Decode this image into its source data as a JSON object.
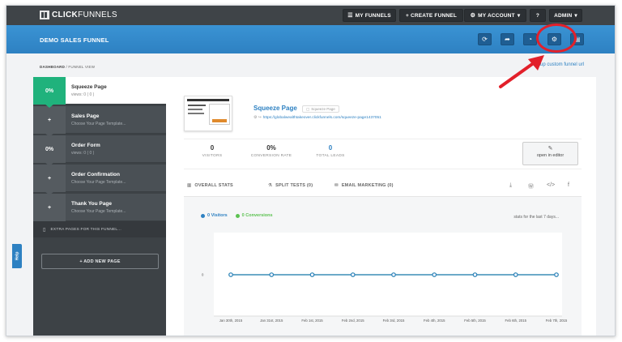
{
  "brand": {
    "name_bold": "CLICK",
    "name_light": "FUNNELS"
  },
  "topnav": {
    "my_funnels": "MY FUNNELS",
    "create_funnel": "+ CREATE FUNNEL",
    "my_account": "MY ACCOUNT",
    "help": "?",
    "admin": "ADMIN"
  },
  "funnel": {
    "title": "DEMO SALES FUNNEL"
  },
  "breadcrumb": {
    "root": "DASHBOARD",
    "sep": "/",
    "current": "FUNNEL VIEW"
  },
  "setup_link": "setup custom funnel url",
  "steps": [
    {
      "pct": "0%",
      "name": "Squeeze Page",
      "sub": "views: 0 ( 0 )",
      "active": true
    },
    {
      "pct": "+",
      "name": "Sales Page",
      "sub": "Choose Your Page Template...",
      "active": false
    },
    {
      "pct": "0%",
      "name": "Order Form",
      "sub": "views: 0 ( 0 )",
      "active": false
    },
    {
      "pct": "+",
      "name": "Order Confirmation",
      "sub": "Choose Your Page Template...",
      "active": false
    },
    {
      "pct": "+",
      "name": "Thank You Page",
      "sub": "Choose Your Page Template...",
      "active": false
    }
  ],
  "extra_pages": "EXTRA PAGES FOR THIS FUNNEL...",
  "add_new_page": "+ ADD NEW PAGE",
  "help_tab": "Help",
  "page": {
    "title": "Squeeze Page",
    "badge": "Squeeze Page",
    "url": "https://globalwealthtakeover.clickfunnels.com/squeeze-page1437051"
  },
  "stats": [
    {
      "value": "0",
      "label": "VISITORS"
    },
    {
      "value": "0%",
      "label": "CONVERSION RATE"
    },
    {
      "value": "0",
      "label": "TOTAL LEADS"
    }
  ],
  "open_editor": "open in editor",
  "tabs": {
    "overall": "OVERALL STATS",
    "split": "SPLIT TESTS (0)",
    "email": "EMAIL MARKETING (0)"
  },
  "legend": {
    "visitors": "0 Visitors",
    "conversions": "0 Conversions"
  },
  "range_text": "stats for the last 7 days...",
  "colors": {
    "visitors": "#2e81c2",
    "conversions": "#5cc251",
    "accent_green": "#20b27c",
    "brand_blue": "#2e81c2",
    "annotation_red": "#e2202a"
  },
  "chart_data": {
    "type": "line",
    "categories": [
      "Jan 30th, 2015",
      "Jan 31st, 2015",
      "Feb 1st, 2015",
      "Feb 2nd, 2015",
      "Feb 3rd, 2015",
      "Feb 4th, 2015",
      "Feb 5th, 2015",
      "Feb 6th, 2015",
      "Feb 7th, 2015"
    ],
    "series": [
      {
        "name": "Visitors",
        "values": [
          0,
          0,
          0,
          0,
          0,
          0,
          0,
          0,
          0
        ]
      },
      {
        "name": "Conversions",
        "values": [
          0,
          0,
          0,
          0,
          0,
          0,
          0,
          0,
          0
        ]
      }
    ],
    "ytick": "0",
    "xlabel": "",
    "ylabel": ""
  }
}
